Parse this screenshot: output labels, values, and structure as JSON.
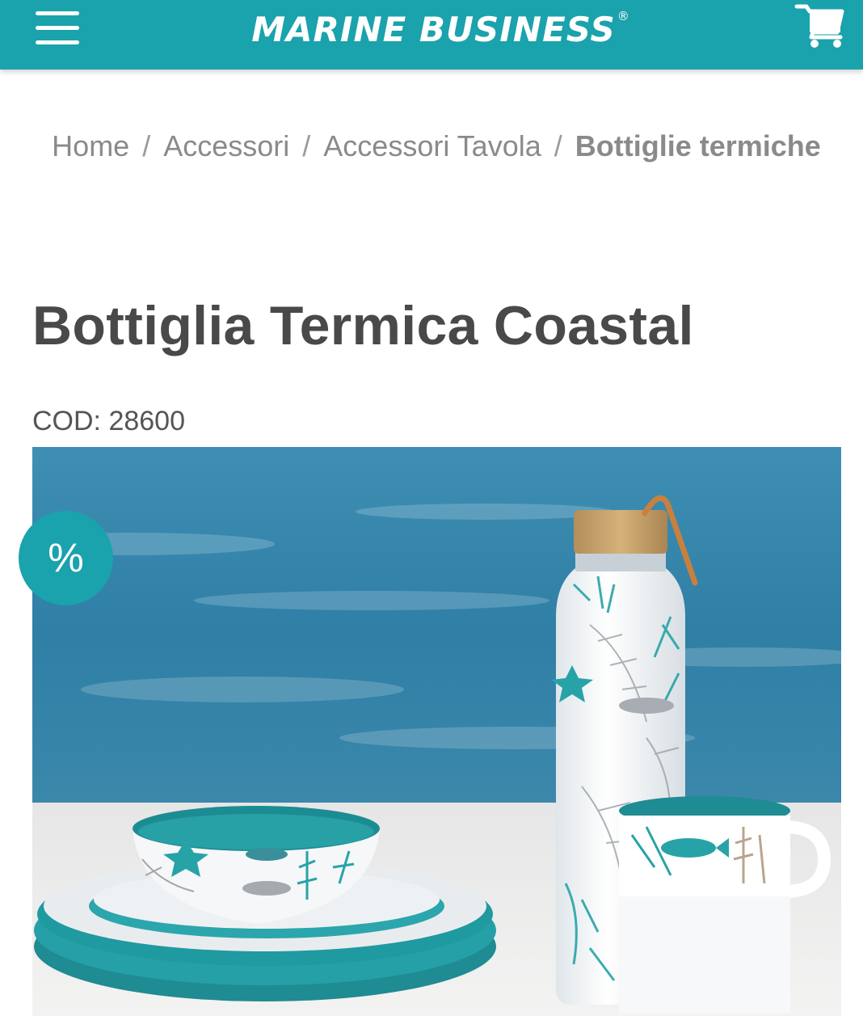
{
  "header": {
    "logo_text": "MARINE BUSINESS",
    "logo_reg": "®",
    "menu_icon": "hamburger-menu-icon",
    "cart_icon": "shopping-cart-icon",
    "accent_color": "#1aa2ad"
  },
  "breadcrumb": {
    "items": [
      "Home",
      "Accessori",
      "Accessori Tavola"
    ],
    "separator": "/",
    "current": "Bottiglie termiche"
  },
  "product": {
    "title": "Bottiglia Termica Coastal",
    "code": "COD: 28600",
    "sale_badge": "%"
  }
}
